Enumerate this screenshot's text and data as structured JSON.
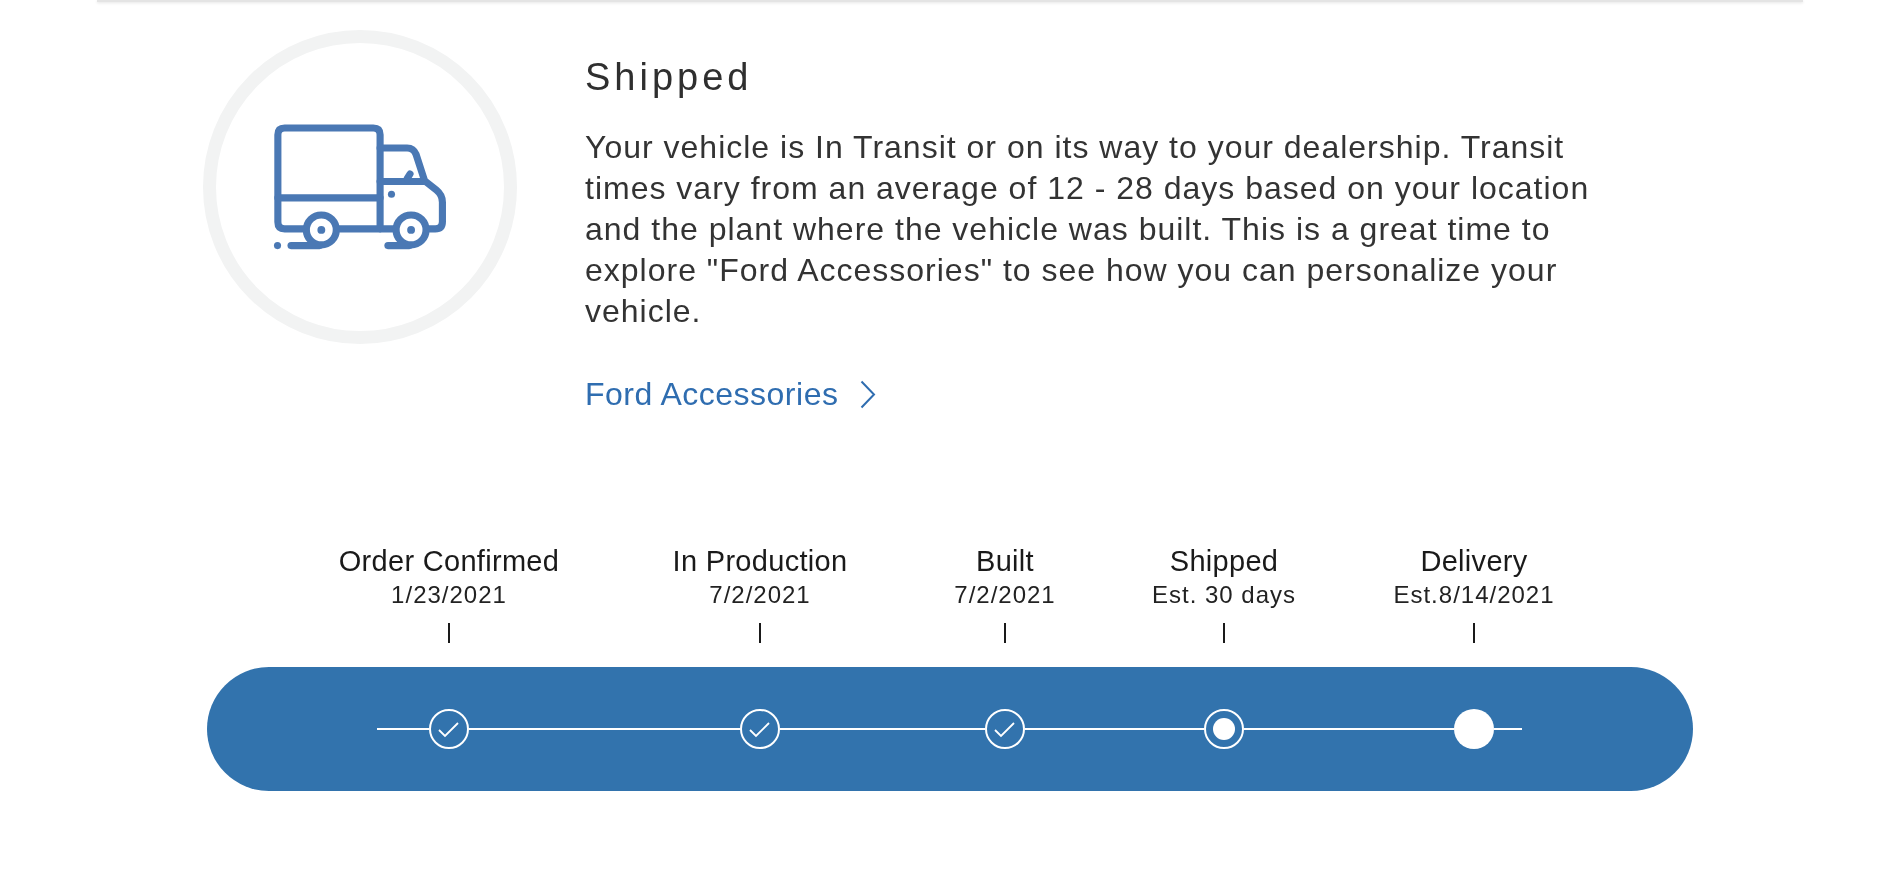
{
  "status_card": {
    "title": "Shipped",
    "description": "Your vehicle is In Transit or on its way to your dealership. Transit times vary from an average of 12 - 28 days based on your location and the plant where the vehicle was built. This is a great time to explore \"Ford Accessories\" to see how you can personalize your vehicle.",
    "link": "Ford Accessories"
  },
  "progress": {
    "steps": [
      {
        "label": "Order Confirmed",
        "date": "1/23/2021",
        "kind": "completed"
      },
      {
        "label": "In Production",
        "date": "7/2/2021",
        "kind": "completed"
      },
      {
        "label": "Built",
        "date": "7/2/2021",
        "kind": "completed"
      },
      {
        "label": "Shipped",
        "date": "Est. 30 days",
        "kind": "current"
      },
      {
        "label": "Delivery",
        "date": "Est.8/14/2021",
        "kind": "upcoming"
      }
    ]
  }
}
